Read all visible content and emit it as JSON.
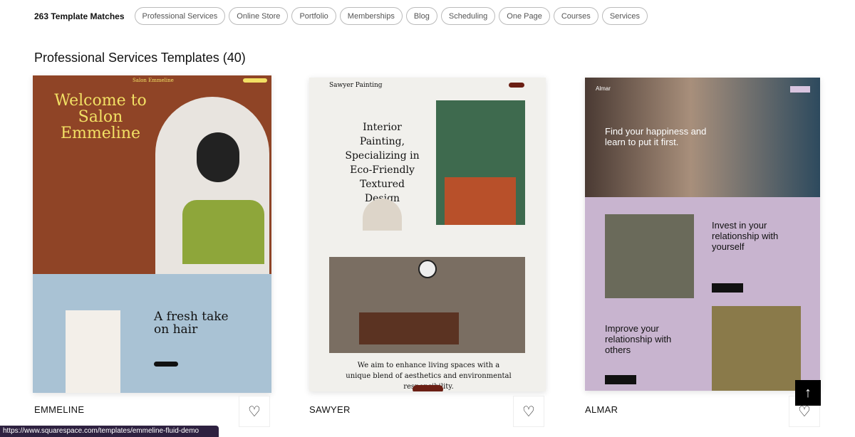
{
  "header": {
    "match_count": "263 Template Matches",
    "filters": [
      "Professional Services",
      "Online Store",
      "Portfolio",
      "Memberships",
      "Blog",
      "Scheduling",
      "One Page",
      "Courses",
      "Services"
    ]
  },
  "section_title": "Professional Services Templates (40)",
  "templates": [
    {
      "name": "EMMELINE",
      "preview": {
        "site_name": "Salon Emmeline",
        "headline": "Welcome to Salon Emmeline",
        "subheadline": "A fresh take on hair",
        "colors": {
          "top": "#8f4426",
          "bottom": "#a9c2d4",
          "accent": "#f2e064"
        }
      }
    },
    {
      "name": "SAWYER",
      "preview": {
        "site_name": "Sawyer Painting",
        "headline": "Interior Painting, Specializing in Eco-Friendly Textured Design",
        "body": "We aim to enhance living spaces with a unique blend of aesthetics and environmental responsibility.",
        "colors": {
          "bg": "#f1f0ec",
          "accent": "#6b1f14"
        }
      }
    },
    {
      "name": "ALMAR",
      "preview": {
        "site_name": "Almar",
        "headline": "Find your happiness and learn to put it first.",
        "section1": "Invest in your relationship with yourself",
        "section2": "Improve your relationship with others",
        "colors": {
          "bg": "#c8b4cf"
        }
      }
    }
  ],
  "favorite_icon": "heart-icon",
  "scroll_top_icon": "arrow-up-icon",
  "status_url": "https://www.squarespace.com/templates/emmeline-fluid-demo"
}
